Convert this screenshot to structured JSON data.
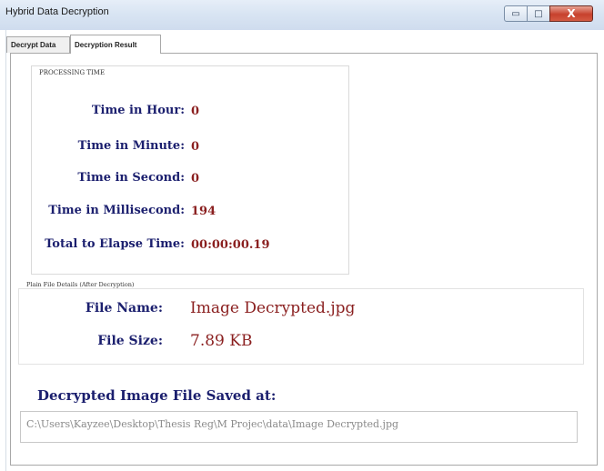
{
  "window": {
    "title": "Hybrid Data Decryption",
    "minimize_glyph": "▭",
    "maximize_glyph": "□",
    "close_glyph": "X"
  },
  "tabs": [
    {
      "label": "Decrypt Data",
      "active": false
    },
    {
      "label": "Decryption Result",
      "active": true
    }
  ],
  "processing_time": {
    "group_title": "PROCESSING TIME",
    "rows": [
      {
        "label": "Time in Hour:",
        "value": "0"
      },
      {
        "label": "Time in Minute:",
        "value": "0"
      },
      {
        "label": "Time in Second:",
        "value": "0"
      },
      {
        "label": "Time in Millisecond:",
        "value": "194"
      },
      {
        "label": "Total to Elapse Time:",
        "value": "00:00:00.19"
      }
    ]
  },
  "plain_file": {
    "group_title": "Plain File Details (After Decryption)",
    "file_name_label": "File Name:",
    "file_name_value": "Image Decrypted.jpg",
    "file_size_label": "File Size:",
    "file_size_value": "7.89 KB"
  },
  "saved": {
    "heading": "Decrypted Image File Saved at:",
    "path": "C:\\Users\\Kayzee\\Desktop\\Thesis Reg\\M Projec\\data\\Image Decrypted.jpg"
  },
  "colors": {
    "label_blue": "#1b1f6e",
    "value_red": "#8a1f1f",
    "close_red": "#c7412d"
  }
}
